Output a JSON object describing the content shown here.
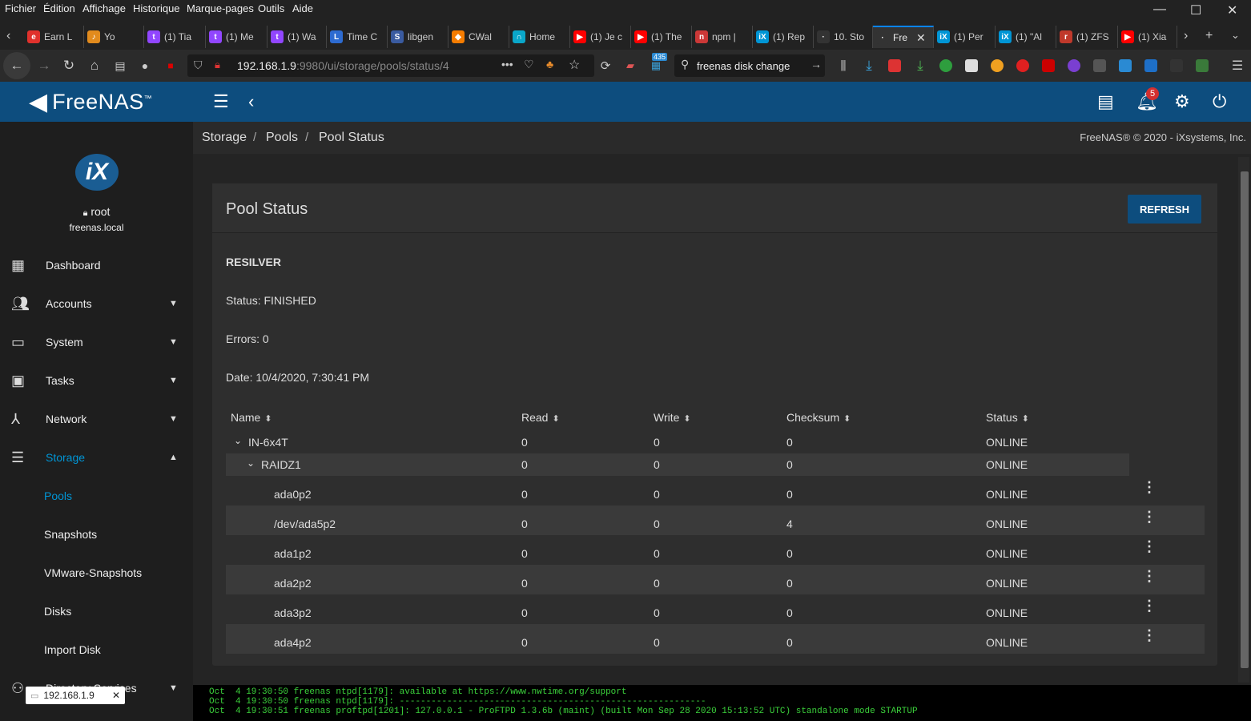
{
  "browser": {
    "menus": [
      "Fichier",
      "Édition",
      "Affichage",
      "Historique",
      "Marque-pages",
      "Outils",
      "Aide"
    ],
    "tabs": [
      {
        "label": "Earn L",
        "color": "#e0312c",
        "glyph": "e"
      },
      {
        "label": "Yo",
        "color": "#e28b1d",
        "glyph": "♪"
      },
      {
        "label": "(1) Tia",
        "color": "#9146ff",
        "glyph": "t"
      },
      {
        "label": "(1) Me",
        "color": "#9146ff",
        "glyph": "t"
      },
      {
        "label": "(1) Wa",
        "color": "#9146ff",
        "glyph": "t"
      },
      {
        "label": "Time C",
        "color": "#2d6bd1",
        "glyph": "L"
      },
      {
        "label": "libgen",
        "color": "#3a5ba0",
        "glyph": "S"
      },
      {
        "label": "CWal",
        "color": "#f57c00",
        "glyph": "◆"
      },
      {
        "label": "Home",
        "color": "#0aa6c9",
        "glyph": "∩"
      },
      {
        "label": "(1) Je c",
        "color": "#ff0000",
        "glyph": "▶"
      },
      {
        "label": "(1) The",
        "color": "#ff0000",
        "glyph": "▶"
      },
      {
        "label": "npm |",
        "color": "#cb3837",
        "glyph": "n"
      },
      {
        "label": "(1) Rep",
        "color": "#0095d5",
        "glyph": "iX"
      },
      {
        "label": "10. Sto",
        "color": "#333333",
        "glyph": "·"
      },
      {
        "label": "Fre",
        "color": "#333333",
        "glyph": "·"
      },
      {
        "label": "(1) Per",
        "color": "#0095d5",
        "glyph": "iX"
      },
      {
        "label": "(1) \"Al",
        "color": "#0095d5",
        "glyph": "iX"
      },
      {
        "label": "(1) ZFS",
        "color": "#c0392b",
        "glyph": "r"
      },
      {
        "label": "(1) Xia",
        "color": "#ff0000",
        "glyph": "▶"
      }
    ],
    "url_host": "192.168.1.9",
    "url_path": ":9980/ui/storage/pools/status/4",
    "search_value": "freenas disk change",
    "badge_count": "435",
    "status_pill": "192.168.1.9"
  },
  "header": {
    "logo_text": "FreeNAS",
    "notification_count": "5"
  },
  "sidebar": {
    "logo": "iX",
    "user": "root",
    "host": "freenas.local",
    "items": [
      {
        "label": "Dashboard",
        "icon": "dashboard-icon",
        "caret": ""
      },
      {
        "label": "Accounts",
        "icon": "accounts-icon",
        "caret": "▼"
      },
      {
        "label": "System",
        "icon": "system-icon",
        "caret": "▼"
      },
      {
        "label": "Tasks",
        "icon": "tasks-icon",
        "caret": "▼"
      },
      {
        "label": "Network",
        "icon": "network-icon",
        "caret": "▼"
      },
      {
        "label": "Storage",
        "icon": "storage-icon",
        "caret": "▲"
      },
      {
        "label": "Directory Services",
        "icon": "directory-icon",
        "caret": "▼"
      }
    ],
    "storage_sub": [
      "Pools",
      "Snapshots",
      "VMware-Snapshots",
      "Disks",
      "Import Disk"
    ]
  },
  "breadcrumb": [
    "Storage",
    "Pools",
    "Pool Status"
  ],
  "copyright": "FreeNAS® © 2020 - iXsystems, Inc.",
  "pool_status": {
    "title": "Pool Status",
    "refresh_label": "REFRESH",
    "scan_type": "RESILVER",
    "status_line": "Status: FINISHED",
    "errors_line": "Errors: 0",
    "date_line": "Date: 10/4/2020, 7:30:41 PM",
    "columns": [
      "Name",
      "Read",
      "Write",
      "Checksum",
      "Status"
    ],
    "rows": [
      {
        "name": "IN-6x4T",
        "read": "0",
        "write": "0",
        "checksum": "0",
        "status": "ONLINE"
      },
      {
        "name": "RAIDZ1",
        "read": "0",
        "write": "0",
        "checksum": "0",
        "status": "ONLINE"
      },
      {
        "name": "ada0p2",
        "read": "0",
        "write": "0",
        "checksum": "0",
        "status": "ONLINE"
      },
      {
        "name": "/dev/ada5p2",
        "read": "0",
        "write": "0",
        "checksum": "4",
        "status": "ONLINE"
      },
      {
        "name": "ada1p2",
        "read": "0",
        "write": "0",
        "checksum": "0",
        "status": "ONLINE"
      },
      {
        "name": "ada2p2",
        "read": "0",
        "write": "0",
        "checksum": "0",
        "status": "ONLINE"
      },
      {
        "name": "ada3p2",
        "read": "0",
        "write": "0",
        "checksum": "0",
        "status": "ONLINE"
      },
      {
        "name": "ada4p2",
        "read": "0",
        "write": "0",
        "checksum": "0",
        "status": "ONLINE"
      }
    ]
  },
  "console": [
    "Oct  4 19:30:50 freenas ntpd[1179]: available at https://www.nwtime.org/support",
    "Oct  4 19:30:50 freenas ntpd[1179]: ----------------------------------------------------------",
    "Oct  4 19:30:51 freenas proftpd[1201]: 127.0.0.1 - ProFTPD 1.3.6b (maint) (built Mon Sep 28 2020 15:13:52 UTC) standalone mode STARTUP"
  ]
}
